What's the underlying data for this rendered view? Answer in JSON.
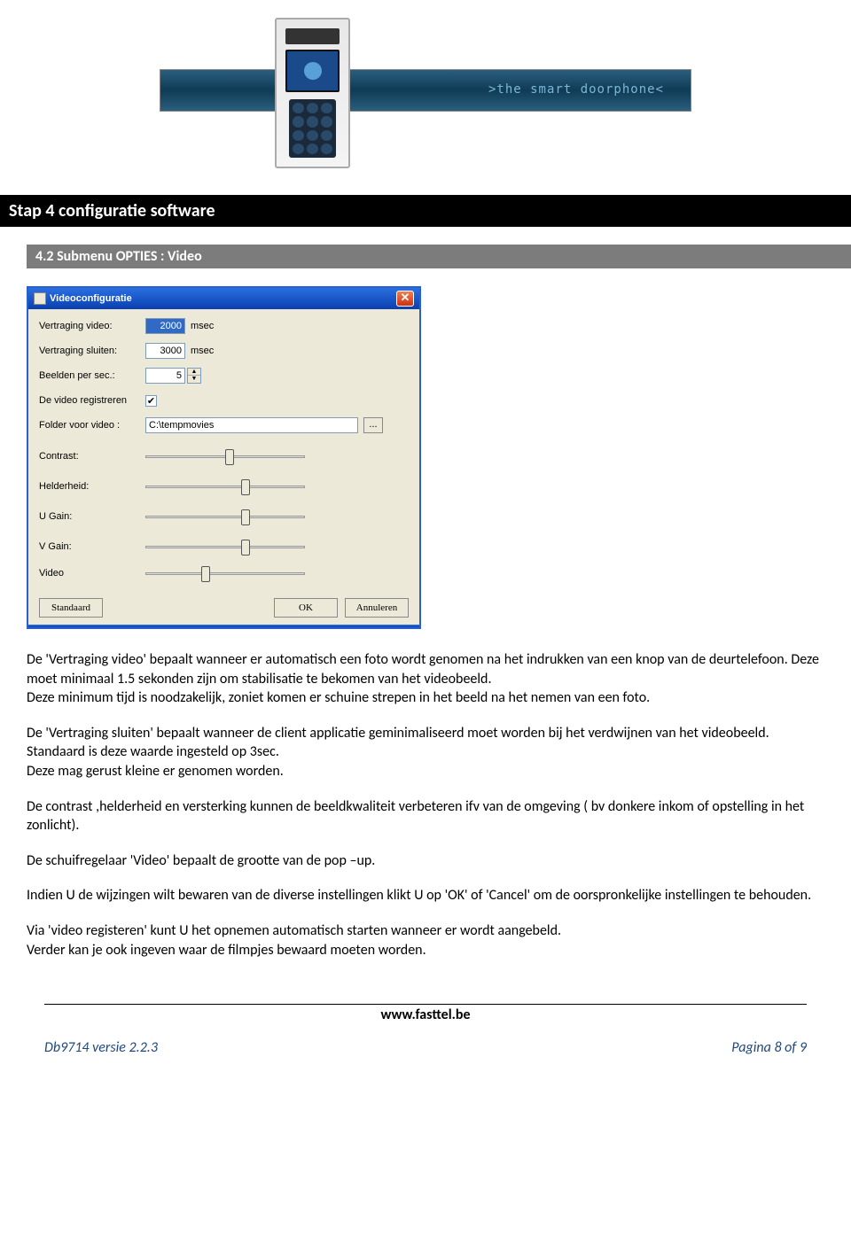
{
  "banner": {
    "tagline": ">the smart doorphone<"
  },
  "section": {
    "title": "Stap 4 configuratie software",
    "subtitle": "4.2 Submenu  OPTIES :  Video"
  },
  "dialog": {
    "title": "Videoconfiguratie",
    "close": "✕",
    "labels": {
      "vertraging_video": "Vertraging video:",
      "vertraging_sluiten": "Vertraging sluiten:",
      "beelden_per_sec": "Beelden per sec.:",
      "video_registreren": "De video registreren",
      "folder_voor_video": "Folder voor video :",
      "contrast": "Contrast:",
      "helderheid": "Helderheid:",
      "u_gain": "U Gain:",
      "v_gain": "V Gain:",
      "video": "Video"
    },
    "values": {
      "vertraging_video": "2000",
      "vertraging_sluiten": "3000",
      "beelden_per_sec": "5",
      "video_registreren_checked": "✔",
      "folder": "C:\\tempmovies"
    },
    "units": {
      "msec": "msec"
    },
    "browse": "...",
    "sliders": {
      "contrast": 50,
      "helderheid": 60,
      "u_gain": 60,
      "v_gain": 60,
      "video": 35
    },
    "buttons": {
      "standaard": "Standaard",
      "ok": "OK",
      "annuleren": "Annuleren"
    }
  },
  "body": {
    "p1": "De 'Vertraging  video' bepaalt wanneer er automatisch een foto wordt genomen na het indrukken van een knop van de deurtelefoon. Deze moet minimaal 1.5 sekonden zijn om stabilisatie te bekomen  van het videobeeld.",
    "p1b": "Deze minimum tijd is noodzakelijk, zoniet komen er schuine strepen in het beeld na het nemen van een foto.",
    "p2": "De 'Vertraging sluiten' bepaalt wanneer de client applicatie geminimaliseerd moet worden bij het verdwijnen van het videobeeld.",
    "p2b": "Standaard is deze waarde ingesteld op 3sec.",
    "p2c": "Deze mag gerust kleine er genomen worden.",
    "p3": "De contrast ,helderheid en versterking kunnen de beeldkwaliteit verbeteren ifv van de omgeving ( bv donkere inkom of opstelling in het zonlicht).",
    "p4": "De schuifregelaar 'Video' bepaalt de grootte van de pop –up.",
    "p5": "Indien U de wijzingen wilt bewaren van de diverse instellingen klikt U op 'OK' of 'Cancel' om de oorspronkelijke instellingen te behouden.",
    "p6": "Via 'video registeren' kunt U het opnemen automatisch starten wanneer er wordt aangebeld.",
    "p6b": "Verder kan je ook ingeven waar de filmpjes bewaard moeten worden."
  },
  "footer": {
    "site": "www.fasttel.be",
    "doc": "Db9714 versie 2.2.3",
    "page": "Pagina 8 of 9"
  }
}
